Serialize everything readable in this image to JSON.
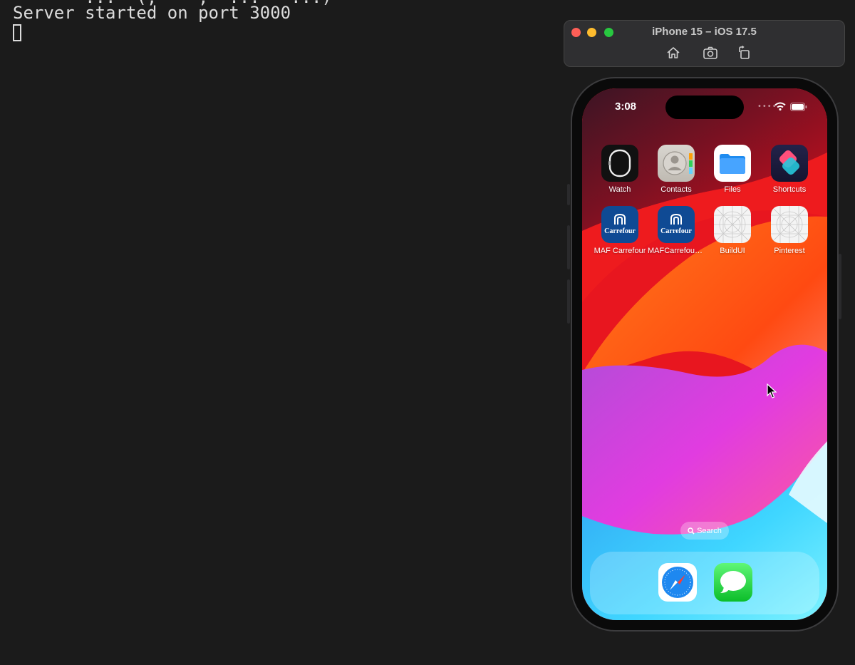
{
  "terminal": {
    "cut_line": "       ...  (,    ,  ...   ...)",
    "line": "Server started on port 3000"
  },
  "simulator": {
    "title": "iPhone 15 – iOS 17.5",
    "toolbar": {
      "home": "home-icon",
      "screenshot": "camera-icon",
      "rotate": "rotate-icon"
    }
  },
  "phone": {
    "status": {
      "time": "3:08",
      "signal": "••••"
    },
    "apps": [
      {
        "label": "Watch"
      },
      {
        "label": "Contacts"
      },
      {
        "label": "Files"
      },
      {
        "label": "Shortcuts"
      },
      {
        "label": "MAF Carrefour",
        "icon_text": "Carrefour"
      },
      {
        "label": "MAFCarrefourT...",
        "icon_text": "Carrefour"
      },
      {
        "label": "BuildUI"
      },
      {
        "label": "Pinterest"
      }
    ],
    "search_label": "Search",
    "dock": [
      {
        "icon": "safari-icon"
      },
      {
        "icon": "messages-icon"
      }
    ]
  },
  "colors": {
    "terminal_bg": "#1b1b1b",
    "carrefour_blue": "#0f4a94",
    "files_blue": "#1f8cf0"
  }
}
